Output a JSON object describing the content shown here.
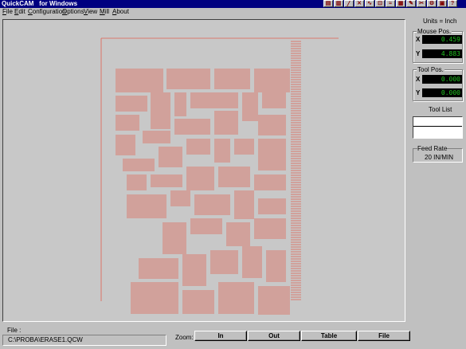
{
  "window": {
    "title": "QuickCAM   for Windows"
  },
  "menu": [
    "File",
    "Edit",
    "Configuration",
    "Options",
    "View",
    "Mill",
    "About"
  ],
  "units": "Units = Inch",
  "mouse_pos": {
    "label": "Mouse Pos.",
    "x_label": "X",
    "y_label": "Y",
    "x": "0.459",
    "y": "4.883"
  },
  "tool_pos": {
    "label": "Tool Pos.",
    "x_label": "X",
    "y_label": "Y",
    "x": "0.000",
    "y": "0.000"
  },
  "tool_list": {
    "label": "Tool List"
  },
  "feed_rate": {
    "label": "Feed Rate",
    "value": "20 IN/MIN"
  },
  "file": {
    "label": "File :",
    "path": "C:\\PROBA\\ERASE1.QCW"
  },
  "zoom": {
    "label": "Zoom:",
    "buttons": [
      "In",
      "Out",
      "Table",
      "File"
    ]
  },
  "colors": {
    "toolpath": "#e06050",
    "lcd_text": "#20c020",
    "title_bar": "#000080"
  }
}
